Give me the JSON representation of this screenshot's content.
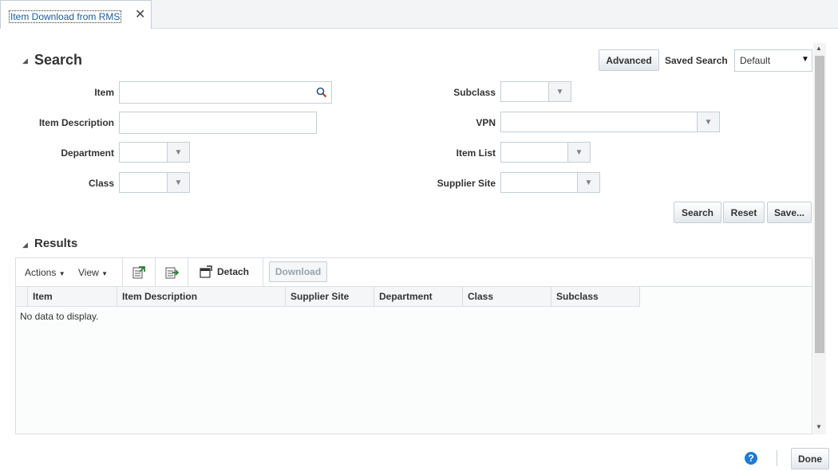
{
  "tab": {
    "title": "Item Download from RMS",
    "close_glyph": "✕"
  },
  "search": {
    "title": "Search",
    "advanced_label": "Advanced",
    "saved_search_label": "Saved Search",
    "saved_search_value": "Default",
    "fields": {
      "item": "Item",
      "item_description": "Item Description",
      "department": "Department",
      "class": "Class",
      "subclass": "Subclass",
      "vpn": "VPN",
      "item_list": "Item List",
      "supplier_site": "Supplier Site"
    },
    "buttons": {
      "search": "Search",
      "reset": "Reset",
      "save": "Save..."
    }
  },
  "results": {
    "title": "Results",
    "toolbar": {
      "actions": "Actions",
      "view": "View",
      "detach": "Detach",
      "download": "Download"
    },
    "columns": [
      "Item",
      "Item Description",
      "Supplier Site",
      "Department",
      "Class",
      "Subclass"
    ],
    "empty_text": "No data to display."
  },
  "footer": {
    "help_glyph": "?",
    "done_label": "Done"
  },
  "colors": {
    "link": "#145c9e",
    "border": "#c4ced7",
    "help": "#1f7ad1"
  }
}
